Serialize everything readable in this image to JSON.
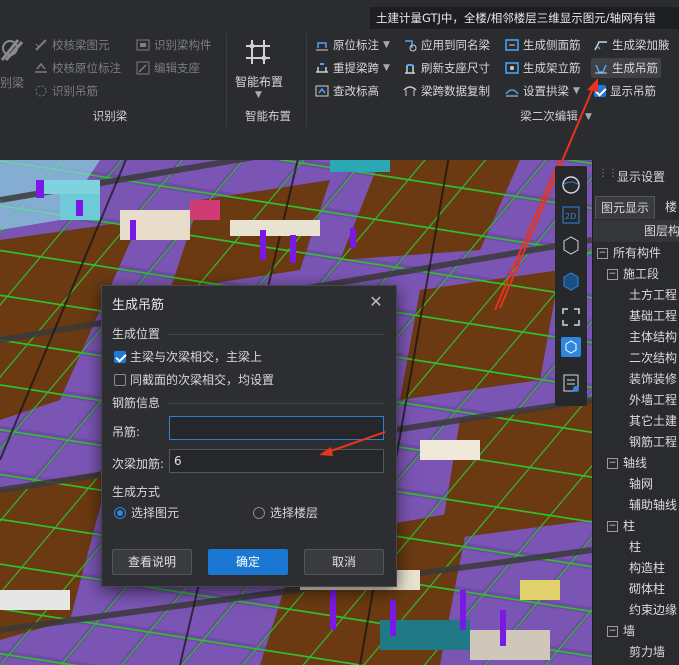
{
  "title": "土建计量GTJ中，全楼/相邻楼层三维显示图元/轴网有错",
  "ribbon": {
    "left_partial_label": "别梁",
    "group1": {
      "items": [
        "校核梁图元",
        "识别梁构件",
        "校核原位标注",
        "编辑支座",
        "识别吊筋"
      ],
      "label": "识别梁"
    },
    "group2": {
      "button": "智能布置",
      "label": "智能布置"
    },
    "group3": {
      "col1": [
        "原位标注",
        "重提梁跨",
        "查改标高"
      ],
      "col2": [
        "应用到同名梁",
        "刷新支座尺寸",
        "梁跨数据复制"
      ],
      "col3": [
        "生成侧面筋",
        "生成架立筋",
        "设置拱梁"
      ],
      "col4": [
        "生成梁加腋",
        "生成吊筋",
        "显示吊筋"
      ],
      "label": "梁二次编辑"
    }
  },
  "right_panel": {
    "title": "显示设置",
    "tabs": [
      "图元显示",
      "楼"
    ],
    "column_header": "图层构",
    "tree": [
      {
        "label": "所有构件",
        "level": 0,
        "expand": "−"
      },
      {
        "label": "施工段",
        "level": 1,
        "expand": "−"
      },
      {
        "label": "土方工程",
        "level": 2
      },
      {
        "label": "基础工程",
        "level": 2
      },
      {
        "label": "主体结构",
        "level": 2
      },
      {
        "label": "二次结构",
        "level": 2
      },
      {
        "label": "装饰装修",
        "level": 2
      },
      {
        "label": "外墙工程",
        "level": 2
      },
      {
        "label": "其它土建",
        "level": 2
      },
      {
        "label": "钢筋工程",
        "level": 2
      },
      {
        "label": "轴线",
        "level": 1,
        "expand": "−"
      },
      {
        "label": "轴网",
        "level": 2
      },
      {
        "label": "辅助轴线",
        "level": 2
      },
      {
        "label": "柱",
        "level": 1,
        "expand": "−"
      },
      {
        "label": "柱",
        "level": 2
      },
      {
        "label": "构造柱",
        "level": 2
      },
      {
        "label": "砌体柱",
        "level": 2
      },
      {
        "label": "约束边缘",
        "level": 2
      },
      {
        "label": "墙",
        "level": 1,
        "expand": "−"
      },
      {
        "label": "剪力墙",
        "level": 2
      }
    ]
  },
  "dialog": {
    "title": "生成吊筋",
    "section1": "生成位置",
    "opt1": "主梁与次梁相交，主梁上",
    "opt1_checked": true,
    "opt2": "同截面的次梁相交，均设置",
    "opt2_checked": false,
    "section2": "钢筋信息",
    "hanger_label": "吊筋:",
    "hanger_value": "",
    "secondary_label": "次梁加筋:",
    "secondary_value": "6",
    "section3": "生成方式",
    "radio1": "选择图元",
    "radio2": "选择楼层",
    "btn_help": "查看说明",
    "btn_ok": "确定",
    "btn_cancel": "取消"
  },
  "colors": {
    "accent": "#1a77d2",
    "arrow": "#e8331e",
    "canvas": "#4a2d73"
  }
}
